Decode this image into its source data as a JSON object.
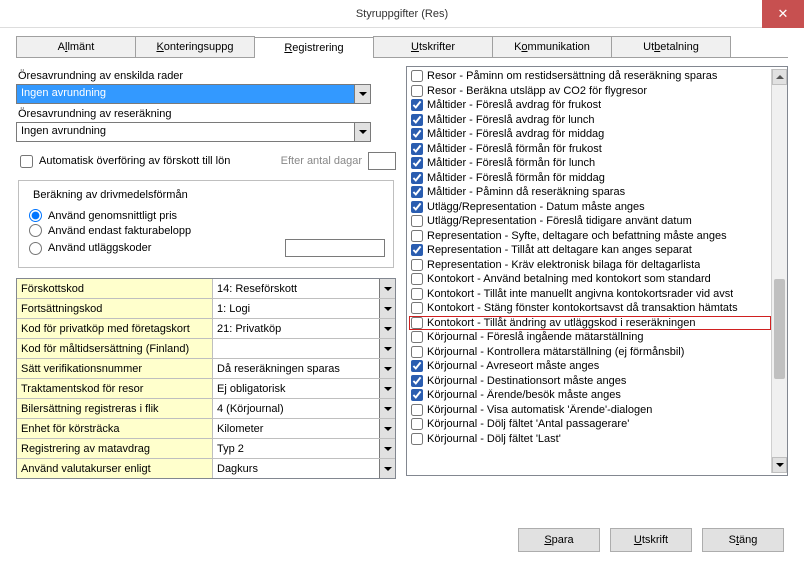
{
  "window": {
    "title": "Styruppgifter (Res)"
  },
  "tabs": [
    {
      "pre": "A",
      "u": "l",
      "post": "lmänt"
    },
    {
      "pre": "",
      "u": "K",
      "post": "onteringsuppg"
    },
    {
      "pre": "",
      "u": "R",
      "post": "egistrering",
      "active": true
    },
    {
      "pre": "",
      "u": "U",
      "post": "tskrifter"
    },
    {
      "pre": "K",
      "u": "o",
      "post": "mmunikation"
    },
    {
      "pre": "Ut",
      "u": "b",
      "post": "etalning"
    }
  ],
  "left": {
    "lbl1": "Öresavrundning av enskilda rader",
    "combo1": "Ingen avrundning",
    "lbl2": "Öresavrundning av reseräkning",
    "combo2": "Ingen avrundning",
    "chk_forskott": "Automatisk överföring av förskott till lön",
    "efter_label": "Efter antal dagar",
    "group_title": "Beräkning av drivmedelsförmån",
    "r1": "Använd genomsnittligt pris",
    "r2": "Använd endast fakturabelopp",
    "r3": "Använd utläggskoder"
  },
  "grid": [
    {
      "k": "Förskottskod",
      "v": "14: Reseförskott"
    },
    {
      "k": "Fortsättningskod",
      "v": " 1: Logi"
    },
    {
      "k": "Kod för privatköp med företagskort",
      "v": "21: Privatköp"
    },
    {
      "k": "Kod för måltidsersättning (Finland)",
      "v": ""
    },
    {
      "k": "Sätt verifikationsnummer",
      "v": "Då reseräkningen sparas"
    },
    {
      "k": "Traktamentskod för resor",
      "v": "Ej obligatorisk"
    },
    {
      "k": "Bilersättning registreras i flik",
      "v": "4 (Körjournal)"
    },
    {
      "k": "Enhet för körsträcka",
      "v": "Kilometer"
    },
    {
      "k": "Registrering av matavdrag",
      "v": "Typ 2"
    },
    {
      "k": "Använd valutakurser enligt",
      "v": "Dagkurs"
    }
  ],
  "checks": [
    {
      "c": false,
      "t": "Resor - Påminn om restidsersättning då reseräkning sparas"
    },
    {
      "c": false,
      "t": "Resor - Beräkna utsläpp av CO2 för flygresor"
    },
    {
      "c": true,
      "t": "Måltider - Föreslå avdrag för frukost"
    },
    {
      "c": true,
      "t": "Måltider - Föreslå avdrag för lunch"
    },
    {
      "c": true,
      "t": "Måltider - Föreslå avdrag för middag"
    },
    {
      "c": true,
      "t": "Måltider - Föreslå förmån för frukost"
    },
    {
      "c": true,
      "t": "Måltider - Föreslå förmån för lunch"
    },
    {
      "c": true,
      "t": "Måltider - Föreslå förmån för middag"
    },
    {
      "c": true,
      "t": "Måltider - Påminn då reseräkning sparas"
    },
    {
      "c": true,
      "t": "Utlägg/Representation - Datum måste anges"
    },
    {
      "c": false,
      "t": "Utlägg/Representation - Föreslå tidigare använt datum"
    },
    {
      "c": false,
      "t": "Representation - Syfte, deltagare och befattning måste anges"
    },
    {
      "c": true,
      "t": "Representation - Tillåt att deltagare kan anges separat"
    },
    {
      "c": false,
      "t": "Representation - Kräv elektronisk bilaga för deltagarlista"
    },
    {
      "c": false,
      "t": "Kontokort - Använd betalning med kontokort som standard"
    },
    {
      "c": false,
      "t": "Kontokort - Tillåt inte manuellt angivna kontokortsrader vid avst"
    },
    {
      "c": false,
      "t": "Kontokort - Stäng fönster kontokortsavst då transaktion hämtats"
    },
    {
      "c": false,
      "t": "Kontokort - Tillåt ändring av utläggskod i reseräkningen",
      "hl": true
    },
    {
      "c": false,
      "t": "Körjournal - Föreslå ingående mätarställning"
    },
    {
      "c": false,
      "t": "Körjournal - Kontrollera mätarställning (ej förmånsbil)"
    },
    {
      "c": true,
      "t": "Körjournal - Avreseort måste anges"
    },
    {
      "c": true,
      "t": "Körjournal - Destinationsort måste anges"
    },
    {
      "c": true,
      "t": "Körjournal - Ärende/besök måste anges"
    },
    {
      "c": false,
      "t": "Körjournal - Visa automatisk 'Ärende'-dialogen"
    },
    {
      "c": false,
      "t": "Körjournal - Dölj fältet 'Antal passagerare'"
    },
    {
      "c": false,
      "t": "Körjournal - Dölj fältet 'Last'"
    }
  ],
  "footer": {
    "save": {
      "u": "S",
      "post": "para"
    },
    "print": {
      "u": "U",
      "post": "tskrift"
    },
    "close": {
      "pre": "S",
      "u": "t",
      "post": "äng"
    }
  }
}
